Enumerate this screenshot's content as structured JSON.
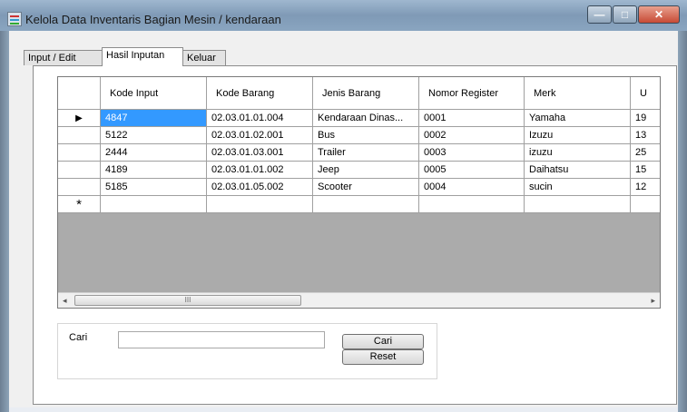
{
  "window": {
    "title": "Kelola Data Inventaris Bagian Mesin / kendaraan",
    "buttons": {
      "minimize": "—",
      "maximize": "□",
      "close": "✕"
    }
  },
  "tabs": [
    {
      "label": "Input / Edit",
      "active": false
    },
    {
      "label": "Hasil Inputan",
      "active": true
    },
    {
      "label": "Keluar",
      "active": false
    }
  ],
  "grid": {
    "columns": [
      "Kode Input",
      "Kode Barang",
      "Jenis Barang",
      "Nomor Register",
      "Merk",
      "U"
    ],
    "rows": [
      {
        "marker": "▶",
        "cells": [
          "4847",
          "02.03.01.01.004",
          "Kendaraan Dinas...",
          "0001",
          "Yamaha",
          "19"
        ]
      },
      {
        "marker": "",
        "cells": [
          "5122",
          "02.03.01.02.001",
          "Bus",
          "0002",
          "Izuzu",
          "13"
        ]
      },
      {
        "marker": "",
        "cells": [
          "2444",
          "02.03.01.03.001",
          "Trailer",
          "0003",
          "izuzu",
          "25"
        ]
      },
      {
        "marker": "",
        "cells": [
          "4189",
          "02.03.01.01.002",
          "Jeep",
          "0005",
          "Daihatsu",
          "15"
        ]
      },
      {
        "marker": "",
        "cells": [
          "5185",
          "02.03.01.05.002",
          "Scooter",
          "0004",
          "sucin",
          "12"
        ]
      }
    ],
    "new_row_marker": "*",
    "scroll": {
      "left_arrow": "◂",
      "right_arrow": "▸",
      "thumb_grip": "III"
    }
  },
  "search": {
    "label": "Cari",
    "input_value": "",
    "search_button": "Cari",
    "reset_button": "Reset"
  }
}
